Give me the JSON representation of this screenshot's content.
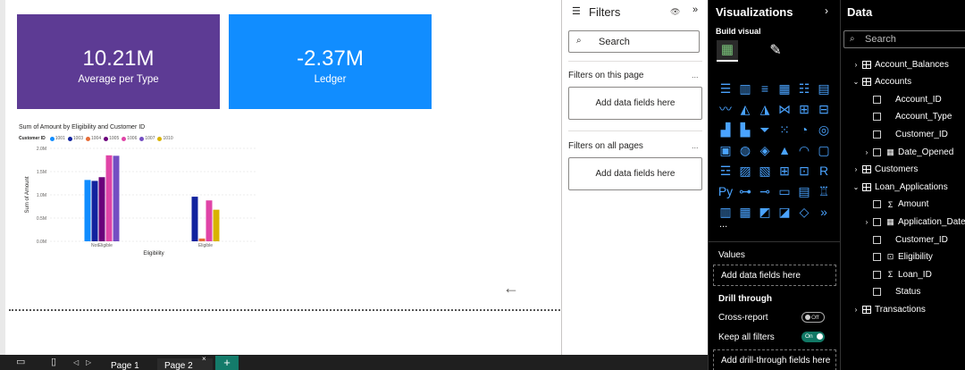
{
  "cards": [
    {
      "value": "10.21M",
      "label": "Average per Type"
    },
    {
      "value": "-2.37M",
      "label": "Ledger"
    }
  ],
  "chart_data": {
    "type": "bar",
    "title": "Sum of Amount by Eligibility and Customer  ID",
    "legend_title": "Customer  ID",
    "legend_position": "top-left",
    "xlabel": "Eligibility",
    "ylabel": "Sum of Amount",
    "categories": [
      "NotEligible",
      "Eligible"
    ],
    "ylim": [
      0,
      2000000
    ],
    "yticks": [
      0,
      500000,
      1000000,
      1500000,
      2000000
    ],
    "ytick_labels": [
      "0.0M",
      "0.5M",
      "1.0M",
      "1.5M",
      "2.0M"
    ],
    "grid": true,
    "series": [
      {
        "name": "1001",
        "color": "#118dff",
        "values": [
          1320000,
          0
        ]
      },
      {
        "name": "1003",
        "color": "#12239e",
        "values": [
          1300000,
          960000
        ]
      },
      {
        "name": "1004",
        "color": "#e66c37",
        "values": [
          0,
          60000
        ]
      },
      {
        "name": "1005",
        "color": "#6b007b",
        "values": [
          1380000,
          0
        ]
      },
      {
        "name": "1006",
        "color": "#e044a7",
        "values": [
          1850000,
          880000
        ]
      },
      {
        "name": "1007",
        "color": "#744ec2",
        "values": [
          1840000,
          0
        ]
      },
      {
        "name": "1010",
        "color": "#d9b300",
        "values": [
          0,
          680000
        ]
      }
    ]
  },
  "filters": {
    "title": "Filters",
    "search_placeholder": "Search",
    "on_this_page": "Filters on this page",
    "on_all_pages": "Filters on all pages",
    "add_fields": "Add data fields here",
    "more": "..."
  },
  "viz": {
    "title": "Visualizations",
    "build_visual": "Build visual",
    "values_label": "Values",
    "values_drop": "Add data fields here",
    "drill_through": "Drill through",
    "cross_report": "Cross-report",
    "cross_toggle": "Off",
    "keep_all_filters": "Keep all filters",
    "keep_toggle": "On",
    "drill_drop": "Add drill-through fields here",
    "more": "..."
  },
  "data_pane": {
    "title": "Data",
    "search_placeholder": "Search",
    "tree": [
      {
        "label": "Account_Balances",
        "type": "table",
        "expanded": false
      },
      {
        "label": "Accounts",
        "type": "table",
        "expanded": true
      },
      {
        "label": "Account_ID",
        "type": "field"
      },
      {
        "label": "Account_Type",
        "type": "field"
      },
      {
        "label": "Customer_ID",
        "type": "field"
      },
      {
        "label": "Date_Opened",
        "type": "date-field"
      },
      {
        "label": "Customers",
        "type": "table",
        "expanded": false
      },
      {
        "label": "Loan_Applications",
        "type": "table",
        "expanded": true
      },
      {
        "label": "Amount",
        "type": "sum-field"
      },
      {
        "label": "Application_Date",
        "type": "date-field"
      },
      {
        "label": "Customer_ID",
        "type": "field"
      },
      {
        "label": "Eligibility",
        "type": "calc-field"
      },
      {
        "label": "Loan_ID",
        "type": "sum-field"
      },
      {
        "label": "Status",
        "type": "field"
      },
      {
        "label": "Transactions",
        "type": "table",
        "expanded": false
      }
    ]
  },
  "pages": {
    "tab1": "Page 1",
    "tab2": "Page 2",
    "close": "×",
    "add": "+"
  }
}
